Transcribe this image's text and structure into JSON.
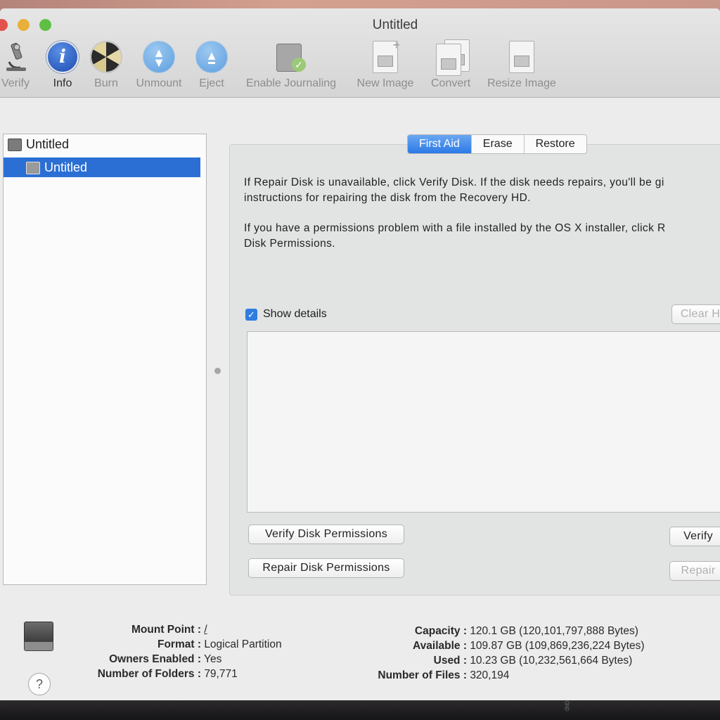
{
  "window": {
    "title": "Untitled"
  },
  "toolbar": {
    "verify": "Verify",
    "info": "Info",
    "burn": "Burn",
    "unmount": "Unmount",
    "eject": "Eject",
    "enable_journaling": "Enable Journaling",
    "new_image": "New Image",
    "convert": "Convert",
    "resize_image": "Resize Image"
  },
  "sidebar": {
    "items": [
      {
        "label": "Untitled",
        "icon": "hard-disk-icon"
      },
      {
        "label": "Untitled",
        "icon": "volume-icon",
        "selected": true
      }
    ]
  },
  "tabs": [
    "First Aid",
    "Erase",
    "Restore"
  ],
  "first_aid": {
    "para1_line1": "If Repair Disk is unavailable, click Verify Disk. If the disk needs repairs, you'll be gi",
    "para1_line2": "instructions for repairing the disk from the Recovery HD.",
    "para2_line1": "If you have a permissions problem with a file installed by the OS X installer, click R",
    "para2_line2": "Disk Permissions.",
    "show_details": "Show details",
    "show_details_checked": true,
    "clear_history": "Clear H",
    "verify_permissions": "Verify Disk Permissions",
    "repair_permissions": "Repair Disk Permissions",
    "verify_disk": "Verify",
    "repair_disk": "Repair"
  },
  "info": {
    "mount_point_label": "Mount Point :",
    "mount_point_value": "/",
    "format_label": "Format :",
    "format_value": "Logical Partition",
    "owners_label": "Owners Enabled :",
    "owners_value": "Yes",
    "folders_label": "Number of Folders :",
    "folders_value": "79,771",
    "capacity_label": "Capacity :",
    "capacity_value": "120.1 GB (120,101,797,888 Bytes)",
    "available_label": "Available :",
    "available_value": "109.87 GB (109,869,236,224 Bytes)",
    "used_label": "Used :",
    "used_value": "10.23 GB (10,232,561,664 Bytes)",
    "files_label": "Number of Files :",
    "files_value": "320,194",
    "help": "?"
  }
}
